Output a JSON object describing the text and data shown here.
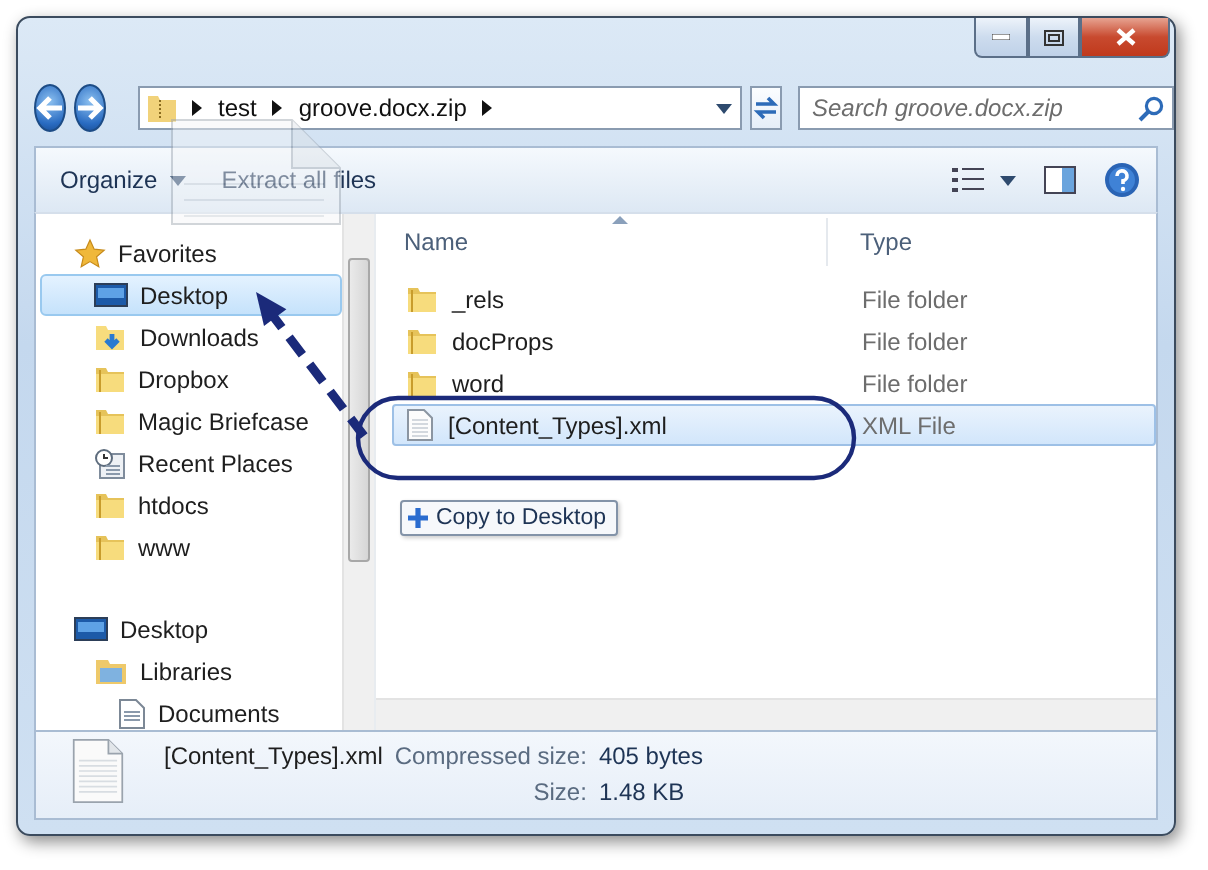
{
  "address_bar": {
    "segments": [
      "test",
      "groove.docx.zip"
    ]
  },
  "search": {
    "placeholder": "Search groove.docx.zip"
  },
  "toolbar": {
    "buttons": [
      {
        "label": "Organize",
        "kind": "menu"
      },
      {
        "label": "Extract all files",
        "kind": "plain"
      }
    ]
  },
  "navigation": [
    {
      "label": "Favorites",
      "kind": "star",
      "selected": false,
      "children": [
        {
          "label": "Desktop",
          "kind": "desktop",
          "selected": true
        },
        {
          "label": "Downloads",
          "kind": "downloads",
          "selected": false
        },
        {
          "label": "Dropbox",
          "kind": "folder",
          "selected": false
        },
        {
          "label": "Magic Briefcase",
          "kind": "folder",
          "selected": false
        },
        {
          "label": "Recent Places",
          "kind": "recent",
          "selected": false
        },
        {
          "label": "htdocs",
          "kind": "folder",
          "selected": false
        },
        {
          "label": "www",
          "kind": "folder",
          "selected": false
        }
      ]
    },
    {
      "label": "Desktop",
      "kind": "desktop",
      "selected": false,
      "children": [
        {
          "label": "Libraries",
          "kind": "library",
          "selected": false,
          "children": [
            {
              "label": "Documents",
              "kind": "document",
              "selected": false
            }
          ]
        }
      ]
    }
  ],
  "files": {
    "columns": [
      "Name",
      "Type"
    ],
    "rows": [
      {
        "name": "_rels",
        "type": "File folder",
        "kind": "folder",
        "selected": false
      },
      {
        "name": "docProps",
        "type": "File folder",
        "kind": "folder",
        "selected": false
      },
      {
        "name": "word",
        "type": "File folder",
        "kind": "folder",
        "selected": false
      },
      {
        "name": "[Content_Types].xml",
        "type": "XML File",
        "kind": "file",
        "selected": true
      }
    ]
  },
  "drag": {
    "tooltip": "Copy to Desktop"
  },
  "details": {
    "name": "[Content_Types].xml",
    "fields": [
      {
        "label": "Compressed size:",
        "value": "405 bytes"
      },
      {
        "label": "Size:",
        "value": "1.48 KB"
      }
    ]
  }
}
